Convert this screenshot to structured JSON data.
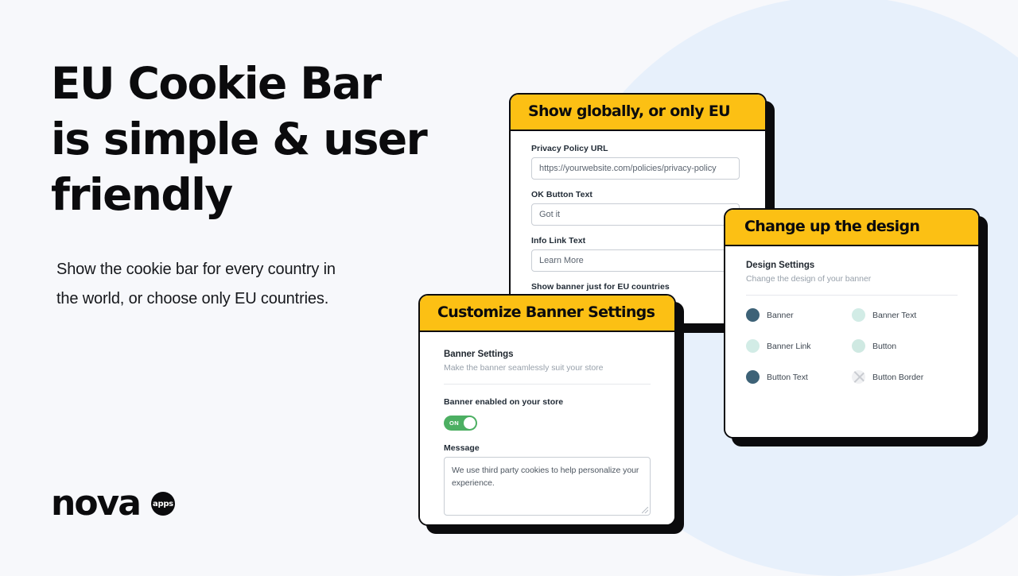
{
  "theme": {
    "page_background": "#f7f8fb",
    "decor_circle": "#e7f0fb",
    "accent_yellow": "#fcc014",
    "ink": "#0b0b0d",
    "toggle_green": "#4caf62"
  },
  "hero": {
    "headline": "EU Cookie Bar is simple & user friendly",
    "subcopy": "Show the cookie bar for every country in the world, or choose only EU countries."
  },
  "logo": {
    "wordmark": "nova",
    "badge_text": "apps"
  },
  "cards": {
    "globally": {
      "header": "Show globally, or only EU",
      "fields": [
        {
          "label": "Privacy Policy URL",
          "value": "https://yourwebsite.com/policies/privacy-policy"
        },
        {
          "label": "OK Button Text",
          "value": "Got it"
        },
        {
          "label": "Info Link Text",
          "value": "Learn More"
        }
      ],
      "toggle": {
        "label": "Show banner just for EU countries",
        "state": "ON"
      }
    },
    "banner": {
      "header": "Customize Banner Settings",
      "section_title": "Banner Settings",
      "section_sub": "Make the banner seamlessly suit your store",
      "toggle": {
        "label": "Banner enabled on your store",
        "state": "ON"
      },
      "message": {
        "label": "Message",
        "value": "We use third party cookies to help personalize your experience."
      }
    },
    "design": {
      "header": "Change up the design",
      "section_title": "Design Settings",
      "section_sub": "Change the design of your banner",
      "swatches": [
        {
          "label": "Banner",
          "color": "#3d6277"
        },
        {
          "label": "Banner Text",
          "color": "#d2ece6"
        },
        {
          "label": "Banner Link",
          "color": "#d2ece6"
        },
        {
          "label": "Button",
          "color": "#cfe9e2"
        },
        {
          "label": "Button Text",
          "color": "#3d6277"
        },
        {
          "label": "Button Border",
          "color": "none"
        }
      ]
    }
  }
}
